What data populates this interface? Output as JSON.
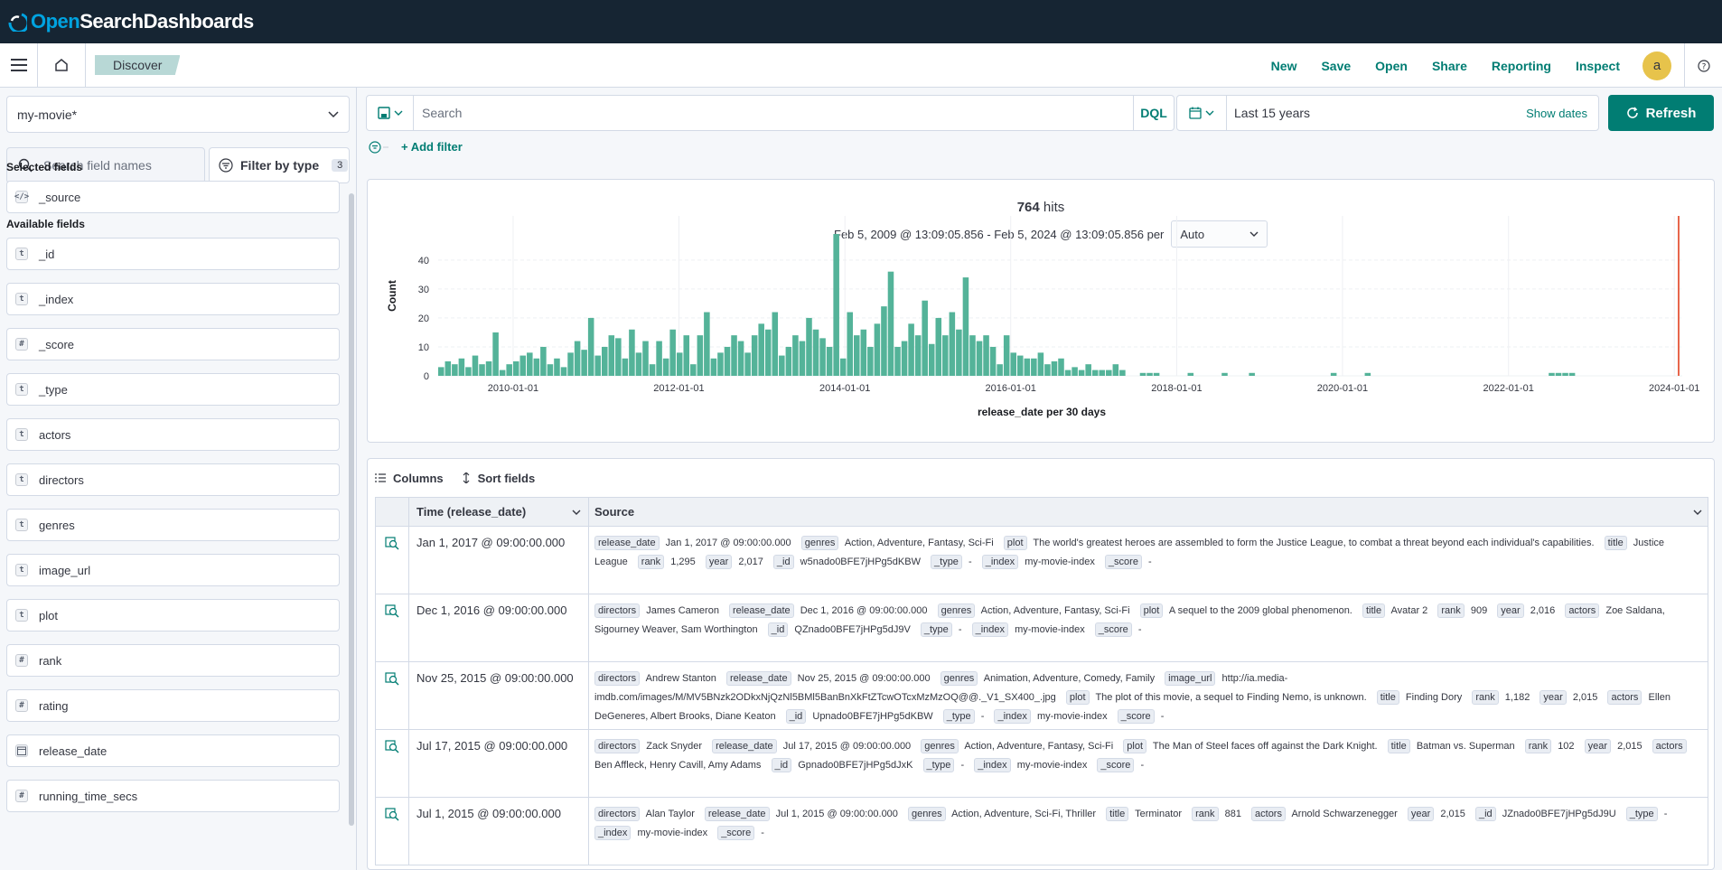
{
  "brand": {
    "name_open": "Open",
    "name_search": "Search",
    "name_dash": " Dashboards"
  },
  "header": {
    "breadcrumb": "Discover",
    "links": [
      "New",
      "Save",
      "Open",
      "Share",
      "Reporting",
      "Inspect"
    ],
    "avatar": "a"
  },
  "sidebar": {
    "index_pattern": "my-movie*",
    "search_placeholder": "Search field names",
    "filter_by_type": "Filter by type",
    "filter_count": "3",
    "selected_title": "Selected fields",
    "selected": [
      {
        "name": "_source",
        "type": "source"
      }
    ],
    "available_title": "Available fields",
    "available": [
      {
        "name": "_id",
        "type": "t"
      },
      {
        "name": "_index",
        "type": "t"
      },
      {
        "name": "_score",
        "type": "#"
      },
      {
        "name": "_type",
        "type": "t"
      },
      {
        "name": "actors",
        "type": "t"
      },
      {
        "name": "directors",
        "type": "t"
      },
      {
        "name": "genres",
        "type": "t"
      },
      {
        "name": "image_url",
        "type": "t"
      },
      {
        "name": "plot",
        "type": "t"
      },
      {
        "name": "rank",
        "type": "#"
      },
      {
        "name": "rating",
        "type": "#"
      },
      {
        "name": "release_date",
        "type": "date"
      },
      {
        "name": "running_time_secs",
        "type": "#"
      }
    ]
  },
  "query": {
    "placeholder": "Search",
    "language": "DQL",
    "time_range": "Last 15 years",
    "show_dates": "Show dates",
    "refresh": "Refresh",
    "add_filter": "+ Add filter"
  },
  "histogram": {
    "hits_count": "764",
    "hits_label": " hits",
    "range_text": "Feb 5, 2009 @ 13:09:05.856 - Feb 5, 2024 @ 13:09:05.856 per",
    "interval": "Auto"
  },
  "chart_data": {
    "type": "bar",
    "ylabel": "Count",
    "xlabel": "release_date per 30 days",
    "ylim": [
      0,
      50
    ],
    "yticks": [
      0,
      10,
      20,
      30,
      40
    ],
    "xticks": [
      "2010-01-01",
      "2012-01-01",
      "2014-01-01",
      "2016-01-01",
      "2018-01-01",
      "2020-01-01",
      "2022-01-01",
      "2024-01-01"
    ],
    "x_start": "2009-02-05",
    "bin_days": 30,
    "grid": true,
    "values": [
      3,
      5,
      4,
      6,
      3,
      7,
      4,
      5,
      15,
      2,
      4,
      5,
      7,
      8,
      6,
      10,
      4,
      6,
      3,
      8,
      12,
      9,
      20,
      7,
      10,
      14,
      13,
      6,
      16,
      8,
      12,
      4,
      12,
      6,
      16,
      8,
      14,
      4,
      14,
      22,
      6,
      8,
      10,
      14,
      12,
      8,
      14,
      18,
      16,
      22,
      7,
      10,
      14,
      12,
      20,
      16,
      13,
      10,
      49,
      6,
      22,
      14,
      16,
      10,
      18,
      24,
      36,
      10,
      12,
      18,
      14,
      26,
      11,
      20,
      14,
      22,
      16,
      34,
      14,
      12,
      14,
      10,
      4,
      14,
      8,
      7,
      6,
      6,
      8,
      4,
      5,
      6,
      2,
      3,
      2,
      4,
      2,
      2,
      2,
      4,
      2,
      0,
      0,
      1,
      1,
      1,
      0,
      0,
      0,
      0,
      1,
      0,
      0,
      0,
      0,
      1,
      0,
      0,
      0,
      1,
      0,
      0,
      0,
      0,
      0,
      0,
      0,
      0,
      0,
      0,
      0,
      1,
      0,
      0,
      0,
      0,
      1,
      0,
      0,
      0,
      0,
      0,
      0,
      0,
      0,
      0,
      0,
      0,
      0,
      0,
      0,
      0,
      0,
      0,
      0,
      0,
      0,
      0,
      0,
      0,
      0,
      0,
      0,
      1,
      1,
      1,
      1
    ]
  },
  "table": {
    "columns_btn": "Columns",
    "sort_btn": "Sort fields",
    "col_time": "Time (release_date)",
    "col_source": "Source",
    "rows": [
      {
        "time": "Jan 1, 2017 @ 09:00:00.000",
        "fields": [
          [
            "release_date",
            "Jan 1, 2017 @ 09:00:00.000"
          ],
          [
            "genres",
            "Action, Adventure, Fantasy, Sci-Fi"
          ],
          [
            "plot",
            "The world's greatest heroes are assembled to form the Justice League, to combat a threat beyond each individual's capabilities."
          ],
          [
            "title",
            "Justice League"
          ],
          [
            "rank",
            "1,295"
          ],
          [
            "year",
            "2,017"
          ],
          [
            "_id",
            "w5nado0BFE7jHPg5dKBW"
          ],
          [
            "_type",
            "-"
          ],
          [
            "_index",
            "my-movie-index"
          ],
          [
            "_score",
            "-"
          ]
        ]
      },
      {
        "time": "Dec 1, 2016 @ 09:00:00.000",
        "fields": [
          [
            "directors",
            "James Cameron"
          ],
          [
            "release_date",
            "Dec 1, 2016 @ 09:00:00.000"
          ],
          [
            "genres",
            "Action, Adventure, Fantasy, Sci-Fi"
          ],
          [
            "plot",
            "A sequel to the 2009 global phenomenon."
          ],
          [
            "title",
            "Avatar 2"
          ],
          [
            "rank",
            "909"
          ],
          [
            "year",
            "2,016"
          ],
          [
            "actors",
            "Zoe Saldana, Sigourney Weaver, Sam Worthington"
          ],
          [
            "_id",
            "QZnado0BFE7jHPg5dJ9V"
          ],
          [
            "_type",
            "-"
          ],
          [
            "_index",
            "my-movie-index"
          ],
          [
            "_score",
            "-"
          ]
        ]
      },
      {
        "time": "Nov 25, 2015 @ 09:00:00.000",
        "fields": [
          [
            "directors",
            "Andrew Stanton"
          ],
          [
            "release_date",
            "Nov 25, 2015 @ 09:00:00.000"
          ],
          [
            "genres",
            "Animation, Adventure, Comedy, Family"
          ],
          [
            "image_url",
            "http://ia.media-imdb.com/images/M/MV5BNzk2ODkxNjQzNl5BMl5BanBnXkFtZTcwOTcxMzMzOQ@@._V1_SX400_.jpg"
          ],
          [
            "plot",
            "The plot of this movie, a sequel to Finding Nemo, is unknown."
          ],
          [
            "title",
            "Finding Dory"
          ],
          [
            "rank",
            "1,182"
          ],
          [
            "year",
            "2,015"
          ],
          [
            "actors",
            "Ellen DeGeneres, Albert Brooks, Diane Keaton"
          ],
          [
            "_id",
            "Upnado0BFE7jHPg5dKBW"
          ],
          [
            "_type",
            "-"
          ],
          [
            "_index",
            "my-movie-index"
          ],
          [
            "_score",
            "-"
          ]
        ]
      },
      {
        "time": "Jul 17, 2015 @ 09:00:00.000",
        "fields": [
          [
            "directors",
            "Zack Snyder"
          ],
          [
            "release_date",
            "Jul 17, 2015 @ 09:00:00.000"
          ],
          [
            "genres",
            "Action, Adventure, Fantasy, Sci-Fi"
          ],
          [
            "plot",
            "The Man of Steel faces off against the Dark Knight."
          ],
          [
            "title",
            "Batman vs. Superman"
          ],
          [
            "rank",
            "102"
          ],
          [
            "year",
            "2,015"
          ],
          [
            "actors",
            "Ben Affleck, Henry Cavill, Amy Adams"
          ],
          [
            "_id",
            "Gpnado0BFE7jHPg5dJxK"
          ],
          [
            "_type",
            "-"
          ],
          [
            "_index",
            "my-movie-index"
          ],
          [
            "_score",
            "-"
          ]
        ]
      },
      {
        "time": "Jul 1, 2015 @ 09:00:00.000",
        "fields": [
          [
            "directors",
            "Alan Taylor"
          ],
          [
            "release_date",
            "Jul 1, 2015 @ 09:00:00.000"
          ],
          [
            "genres",
            "Action, Adventure, Sci-Fi, Thriller"
          ],
          [
            "title",
            "Terminator"
          ],
          [
            "rank",
            "881"
          ],
          [
            "actors",
            "Arnold Schwarzenegger"
          ],
          [
            "year",
            "2,015"
          ],
          [
            "_id",
            "JZnado0BFE7jHPg5dJ9U"
          ],
          [
            "_type",
            "-"
          ],
          [
            "_index",
            "my-movie-index"
          ],
          [
            "_score",
            "-"
          ]
        ]
      }
    ]
  },
  "colors": {
    "accent": "#017d73",
    "bar": "#54b399",
    "now_marker": "#e7664c",
    "brandbar": "#162533"
  }
}
